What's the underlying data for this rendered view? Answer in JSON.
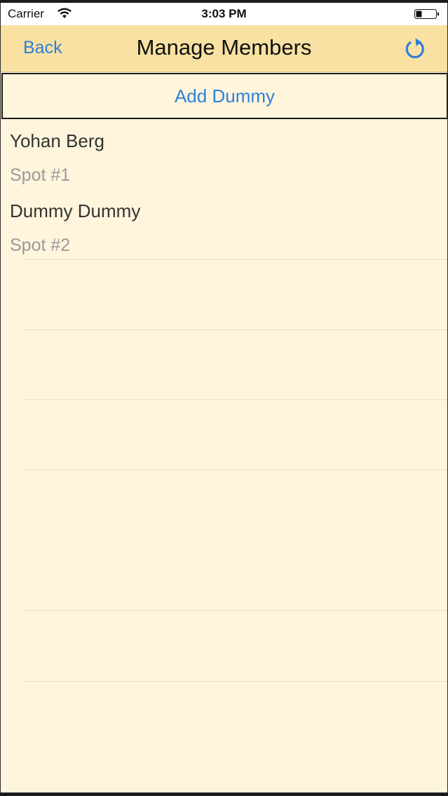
{
  "status_bar": {
    "carrier": "Carrier",
    "time": "3:03 PM",
    "wifi_icon": "wifi-icon",
    "battery_icon": "battery-icon"
  },
  "nav": {
    "back_label": "Back",
    "title": "Manage Members",
    "refresh_icon": "refresh-icon"
  },
  "actions": {
    "add_dummy_label": "Add Dummy"
  },
  "members": [
    {
      "name": "Yohan Berg",
      "spot": "Spot #1"
    },
    {
      "name": "Dummy Dummy",
      "spot": "Spot #2"
    }
  ],
  "colors": {
    "accent": "#2f7fd7",
    "nav_background": "#f8e1a2",
    "page_background": "#fff5dc",
    "secondary_text": "#9a9a9a"
  }
}
